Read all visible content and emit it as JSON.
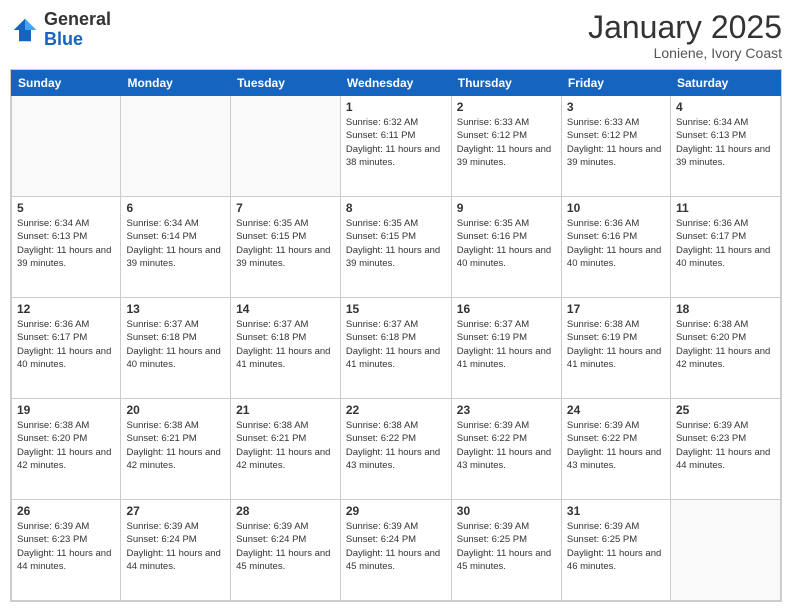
{
  "header": {
    "logo_general": "General",
    "logo_blue": "Blue",
    "month_title": "January 2025",
    "subtitle": "Loniene, Ivory Coast"
  },
  "days_of_week": [
    "Sunday",
    "Monday",
    "Tuesday",
    "Wednesday",
    "Thursday",
    "Friday",
    "Saturday"
  ],
  "weeks": [
    [
      {
        "day": "",
        "info": ""
      },
      {
        "day": "",
        "info": ""
      },
      {
        "day": "",
        "info": ""
      },
      {
        "day": "1",
        "info": "Sunrise: 6:32 AM\nSunset: 6:11 PM\nDaylight: 11 hours\nand 38 minutes."
      },
      {
        "day": "2",
        "info": "Sunrise: 6:33 AM\nSunset: 6:12 PM\nDaylight: 11 hours\nand 39 minutes."
      },
      {
        "day": "3",
        "info": "Sunrise: 6:33 AM\nSunset: 6:12 PM\nDaylight: 11 hours\nand 39 minutes."
      },
      {
        "day": "4",
        "info": "Sunrise: 6:34 AM\nSunset: 6:13 PM\nDaylight: 11 hours\nand 39 minutes."
      }
    ],
    [
      {
        "day": "5",
        "info": "Sunrise: 6:34 AM\nSunset: 6:13 PM\nDaylight: 11 hours\nand 39 minutes."
      },
      {
        "day": "6",
        "info": "Sunrise: 6:34 AM\nSunset: 6:14 PM\nDaylight: 11 hours\nand 39 minutes."
      },
      {
        "day": "7",
        "info": "Sunrise: 6:35 AM\nSunset: 6:15 PM\nDaylight: 11 hours\nand 39 minutes."
      },
      {
        "day": "8",
        "info": "Sunrise: 6:35 AM\nSunset: 6:15 PM\nDaylight: 11 hours\nand 39 minutes."
      },
      {
        "day": "9",
        "info": "Sunrise: 6:35 AM\nSunset: 6:16 PM\nDaylight: 11 hours\nand 40 minutes."
      },
      {
        "day": "10",
        "info": "Sunrise: 6:36 AM\nSunset: 6:16 PM\nDaylight: 11 hours\nand 40 minutes."
      },
      {
        "day": "11",
        "info": "Sunrise: 6:36 AM\nSunset: 6:17 PM\nDaylight: 11 hours\nand 40 minutes."
      }
    ],
    [
      {
        "day": "12",
        "info": "Sunrise: 6:36 AM\nSunset: 6:17 PM\nDaylight: 11 hours\nand 40 minutes."
      },
      {
        "day": "13",
        "info": "Sunrise: 6:37 AM\nSunset: 6:18 PM\nDaylight: 11 hours\nand 40 minutes."
      },
      {
        "day": "14",
        "info": "Sunrise: 6:37 AM\nSunset: 6:18 PM\nDaylight: 11 hours\nand 41 minutes."
      },
      {
        "day": "15",
        "info": "Sunrise: 6:37 AM\nSunset: 6:18 PM\nDaylight: 11 hours\nand 41 minutes."
      },
      {
        "day": "16",
        "info": "Sunrise: 6:37 AM\nSunset: 6:19 PM\nDaylight: 11 hours\nand 41 minutes."
      },
      {
        "day": "17",
        "info": "Sunrise: 6:38 AM\nSunset: 6:19 PM\nDaylight: 11 hours\nand 41 minutes."
      },
      {
        "day": "18",
        "info": "Sunrise: 6:38 AM\nSunset: 6:20 PM\nDaylight: 11 hours\nand 42 minutes."
      }
    ],
    [
      {
        "day": "19",
        "info": "Sunrise: 6:38 AM\nSunset: 6:20 PM\nDaylight: 11 hours\nand 42 minutes."
      },
      {
        "day": "20",
        "info": "Sunrise: 6:38 AM\nSunset: 6:21 PM\nDaylight: 11 hours\nand 42 minutes."
      },
      {
        "day": "21",
        "info": "Sunrise: 6:38 AM\nSunset: 6:21 PM\nDaylight: 11 hours\nand 42 minutes."
      },
      {
        "day": "22",
        "info": "Sunrise: 6:38 AM\nSunset: 6:22 PM\nDaylight: 11 hours\nand 43 minutes."
      },
      {
        "day": "23",
        "info": "Sunrise: 6:39 AM\nSunset: 6:22 PM\nDaylight: 11 hours\nand 43 minutes."
      },
      {
        "day": "24",
        "info": "Sunrise: 6:39 AM\nSunset: 6:22 PM\nDaylight: 11 hours\nand 43 minutes."
      },
      {
        "day": "25",
        "info": "Sunrise: 6:39 AM\nSunset: 6:23 PM\nDaylight: 11 hours\nand 44 minutes."
      }
    ],
    [
      {
        "day": "26",
        "info": "Sunrise: 6:39 AM\nSunset: 6:23 PM\nDaylight: 11 hours\nand 44 minutes."
      },
      {
        "day": "27",
        "info": "Sunrise: 6:39 AM\nSunset: 6:24 PM\nDaylight: 11 hours\nand 44 minutes."
      },
      {
        "day": "28",
        "info": "Sunrise: 6:39 AM\nSunset: 6:24 PM\nDaylight: 11 hours\nand 45 minutes."
      },
      {
        "day": "29",
        "info": "Sunrise: 6:39 AM\nSunset: 6:24 PM\nDaylight: 11 hours\nand 45 minutes."
      },
      {
        "day": "30",
        "info": "Sunrise: 6:39 AM\nSunset: 6:25 PM\nDaylight: 11 hours\nand 45 minutes."
      },
      {
        "day": "31",
        "info": "Sunrise: 6:39 AM\nSunset: 6:25 PM\nDaylight: 11 hours\nand 46 minutes."
      },
      {
        "day": "",
        "info": ""
      }
    ]
  ]
}
